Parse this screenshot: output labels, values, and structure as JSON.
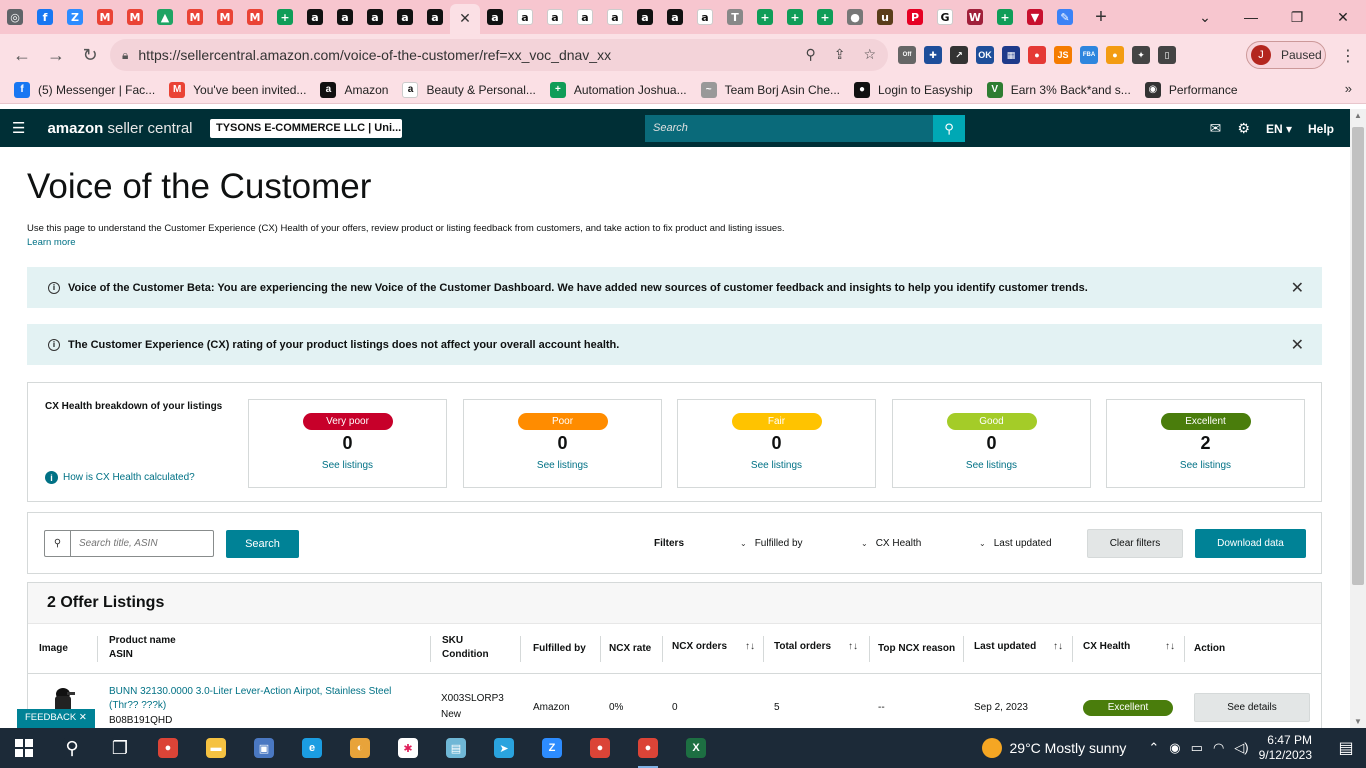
{
  "browser": {
    "tabs": [
      {
        "icon": "chrome-icon",
        "color": "#5f6368",
        "glyph": "◎"
      },
      {
        "icon": "facebook-icon",
        "color": "#1877f2",
        "glyph": "f"
      },
      {
        "icon": "zoom-icon",
        "color": "#2d8cff",
        "glyph": "Z"
      },
      {
        "icon": "gmail-icon",
        "color": "#ea4335",
        "glyph": "M"
      },
      {
        "icon": "gmail-icon",
        "color": "#ea4335",
        "glyph": "M"
      },
      {
        "icon": "drive-icon",
        "color": "#1fa463",
        "glyph": "▲"
      },
      {
        "icon": "gmail-icon",
        "color": "#ea4335",
        "glyph": "M"
      },
      {
        "icon": "gmail-icon",
        "color": "#ea4335",
        "glyph": "M"
      },
      {
        "icon": "gmail-icon",
        "color": "#ea4335",
        "glyph": "M"
      },
      {
        "icon": "sheets-icon",
        "color": "#0f9d58",
        "glyph": "+"
      },
      {
        "icon": "amazon-icon",
        "color": "#111111",
        "glyph": "a"
      },
      {
        "icon": "amazon-icon",
        "color": "#111111",
        "glyph": "a"
      },
      {
        "icon": "amazon-icon",
        "color": "#111111",
        "glyph": "a"
      },
      {
        "icon": "amazon-icon",
        "color": "#111111",
        "glyph": "a"
      },
      {
        "icon": "amazon-icon",
        "color": "#111111",
        "glyph": "a"
      },
      {
        "icon": "close-icon",
        "color": "#fbe0e5",
        "glyph": "✕",
        "active": true
      },
      {
        "icon": "amazon-icon",
        "color": "#111111",
        "glyph": "a"
      },
      {
        "icon": "amazon-smile-icon",
        "color": "#ffffff",
        "glyph": "a"
      },
      {
        "icon": "amazon-smile-icon",
        "color": "#ffffff",
        "glyph": "a"
      },
      {
        "icon": "amazon-smile-icon",
        "color": "#ffffff",
        "glyph": "a"
      },
      {
        "icon": "amazon-smile-icon",
        "color": "#ffffff",
        "glyph": "a"
      },
      {
        "icon": "amazon-icon",
        "color": "#111111",
        "glyph": "a"
      },
      {
        "icon": "amazon-icon",
        "color": "#111111",
        "glyph": "a"
      },
      {
        "icon": "amazon-smile-icon",
        "color": "#ffffff",
        "glyph": "a"
      },
      {
        "icon": "tool-icon",
        "color": "#888888",
        "glyph": "T"
      },
      {
        "icon": "sheets-icon",
        "color": "#0f9d58",
        "glyph": "+"
      },
      {
        "icon": "sheets-icon",
        "color": "#0f9d58",
        "glyph": "+"
      },
      {
        "icon": "sheets-icon",
        "color": "#0f9d58",
        "glyph": "+"
      },
      {
        "icon": "globe-icon",
        "color": "#777777",
        "glyph": "●"
      },
      {
        "icon": "ups-icon",
        "color": "#5a3d1a",
        "glyph": "u"
      },
      {
        "icon": "pinterest-icon",
        "color": "#e60023",
        "glyph": "P"
      },
      {
        "icon": "google-icon",
        "color": "#ffffff",
        "glyph": "G"
      },
      {
        "icon": "vw-icon",
        "color": "#a0203a",
        "glyph": "W"
      },
      {
        "icon": "sheets-icon",
        "color": "#0f9d58",
        "glyph": "+"
      },
      {
        "icon": "triangle-icon",
        "color": "#c8102e",
        "glyph": "▼"
      },
      {
        "icon": "pen-icon",
        "color": "#3b82f6",
        "glyph": "✎"
      }
    ],
    "new_tab": "+",
    "url": "https://sellercentral.amazon.com/voice-of-the-customer/ref=xx_voc_dnav_xx",
    "profile_initial": "J",
    "profile_label": "Paused",
    "extensions": [
      {
        "icon": "coupon-off-icon",
        "color": "#666666",
        "glyph": "Off"
      },
      {
        "icon": "extension-icon",
        "color": "#1e4e9a",
        "glyph": "✚"
      },
      {
        "icon": "cursor-icon",
        "color": "#333333",
        "glyph": "↗"
      },
      {
        "icon": "ok-icon",
        "color": "#1e4e9a",
        "glyph": "OK"
      },
      {
        "icon": "grid-icon",
        "color": "#1e3a8a",
        "glyph": "▦"
      },
      {
        "icon": "pokeball-icon",
        "color": "#e53935",
        "glyph": "●"
      },
      {
        "icon": "js-icon",
        "color": "#f57c00",
        "glyph": "JS"
      },
      {
        "icon": "fba-icon",
        "color": "#2e86de",
        "glyph": "FBA"
      },
      {
        "icon": "fire-icon",
        "color": "#f39c12",
        "glyph": "●"
      },
      {
        "icon": "puzzle-icon",
        "color": "#444444",
        "glyph": "✦"
      },
      {
        "icon": "sidepanel-icon",
        "color": "#444444",
        "glyph": "▯"
      }
    ]
  },
  "bookmarks": [
    {
      "icon": "facebook-icon",
      "color": "#1877f2",
      "glyph": "f",
      "label": "(5) Messenger | Fac..."
    },
    {
      "icon": "gmail-icon",
      "color": "#ea4335",
      "glyph": "M",
      "label": "You've been invited..."
    },
    {
      "icon": "amazon-icon",
      "color": "#111111",
      "glyph": "a",
      "label": "Amazon"
    },
    {
      "icon": "amazon-smile-icon",
      "color": "#ffffff",
      "glyph": "a",
      "label": "Beauty & Personal..."
    },
    {
      "icon": "sheets-icon",
      "color": "#0f9d58",
      "glyph": "+",
      "label": "Automation Joshua..."
    },
    {
      "icon": "signature-icon",
      "color": "#999999",
      "glyph": "~",
      "label": "Team Borj Asin Che..."
    },
    {
      "icon": "easyship-icon",
      "color": "#111111",
      "glyph": "●",
      "label": "Login to Easyship"
    },
    {
      "icon": "cashback-icon",
      "color": "#2e7d32",
      "glyph": "V",
      "label": "Earn 3% Back*and s..."
    },
    {
      "icon": "performance-icon",
      "color": "#333333",
      "glyph": "◉",
      "label": "Performance"
    }
  ],
  "header": {
    "logo_bold": "amazon",
    "logo_rest": " seller central",
    "store": "TYSONS E-COMMERCE LLC | Uni...",
    "search_placeholder": "Search",
    "lang": "EN",
    "help": "Help"
  },
  "page": {
    "title": "Voice of the Customer",
    "description": "Use this page to understand the Customer Experience (CX) Health of your offers, review product or listing feedback from customers, and take action to fix product and listing issues.",
    "learn_more": "Learn more",
    "banner1": "Voice of the Customer Beta: You are experiencing the new Voice of the Customer Dashboard. We have added new sources of customer feedback and insights to help you identify customer trends.",
    "banner2": "The Customer Experience (CX) rating of your product listings does not affect your overall account health."
  },
  "cx": {
    "label": "CX Health breakdown of your listings",
    "how": "How is CX Health calculated?",
    "cards": [
      {
        "name": "Very poor",
        "count": "0",
        "link": "See listings",
        "color": "#c7002a"
      },
      {
        "name": "Poor",
        "count": "0",
        "link": "See listings",
        "color": "#ff8c00"
      },
      {
        "name": "Fair",
        "count": "0",
        "link": "See listings",
        "color": "#ffc300"
      },
      {
        "name": "Good",
        "count": "0",
        "link": "See listings",
        "color": "#a4cc28"
      },
      {
        "name": "Excellent",
        "count": "2",
        "link": "See listings",
        "color": "#4a7d0c"
      }
    ]
  },
  "filters": {
    "search_placeholder": "Search title, ASIN",
    "search_button": "Search",
    "label": "Filters",
    "fulfilled_by": "Fulfilled by",
    "cx_health": "CX Health",
    "last_updated": "Last updated",
    "clear": "Clear filters",
    "download": "Download data"
  },
  "table": {
    "title": "2 Offer Listings",
    "headers": {
      "image": "Image",
      "product_name": "Product name",
      "asin": "ASIN",
      "sku": "SKU",
      "condition": "Condition",
      "fulfilled_by": "Fulfilled by",
      "ncx_rate": "NCX rate",
      "ncx_orders": "NCX orders",
      "total_orders": "Total orders",
      "top_ncx_reason": "Top NCX reason",
      "last_updated": "Last updated",
      "cx_health": "CX Health",
      "action": "Action"
    },
    "rows": [
      {
        "product_name": "BUNN 32130.0000 3.0-Liter Lever-Action Airpot, Stainless Steel (Thr?? ???k)",
        "asin": "B08B191QHD",
        "sku": "X003SLORP3",
        "condition": "New",
        "fulfilled_by": "Amazon",
        "ncx_rate": "0%",
        "ncx_orders": "0",
        "total_orders": "5",
        "top_ncx_reason": "--",
        "last_updated": "Sep 2, 2023",
        "cx_health": "Excellent",
        "action": "See details"
      }
    ]
  },
  "feedback": "FEEDBACK ✕",
  "taskbar": {
    "apps": [
      {
        "icon": "search-icon",
        "color": "#1c2a38",
        "glyph": "⚲"
      },
      {
        "icon": "task-view-icon",
        "color": "#1c2a38",
        "glyph": "❐"
      },
      {
        "icon": "chrome-icon",
        "color": "#db4437",
        "glyph": "●"
      },
      {
        "icon": "file-explorer-icon",
        "color": "#f5c242",
        "glyph": "▬"
      },
      {
        "icon": "control-panel-icon",
        "color": "#4a78c2",
        "glyph": "▣"
      },
      {
        "icon": "edge-icon",
        "color": "#1b9de2",
        "glyph": "e"
      },
      {
        "icon": "vpn-icon",
        "color": "#e8a33a",
        "glyph": "◐"
      },
      {
        "icon": "slack-icon",
        "color": "#ffffff",
        "glyph": "✱"
      },
      {
        "icon": "notepad-icon",
        "color": "#6fb7d6",
        "glyph": "▤"
      },
      {
        "icon": "telegram-icon",
        "color": "#2aa3de",
        "glyph": "➤"
      },
      {
        "icon": "zoom-icon",
        "color": "#2d8cff",
        "glyph": "Z"
      },
      {
        "icon": "chrome-profile-icon",
        "color": "#db4437",
        "glyph": "●"
      },
      {
        "icon": "chrome-profile-icon",
        "color": "#db4437",
        "glyph": "●",
        "active": true
      },
      {
        "icon": "excel-icon",
        "color": "#1d6f42",
        "glyph": "X"
      }
    ],
    "weather": "29°C  Mostly sunny",
    "time": "6:47 PM",
    "date": "9/12/2023"
  }
}
